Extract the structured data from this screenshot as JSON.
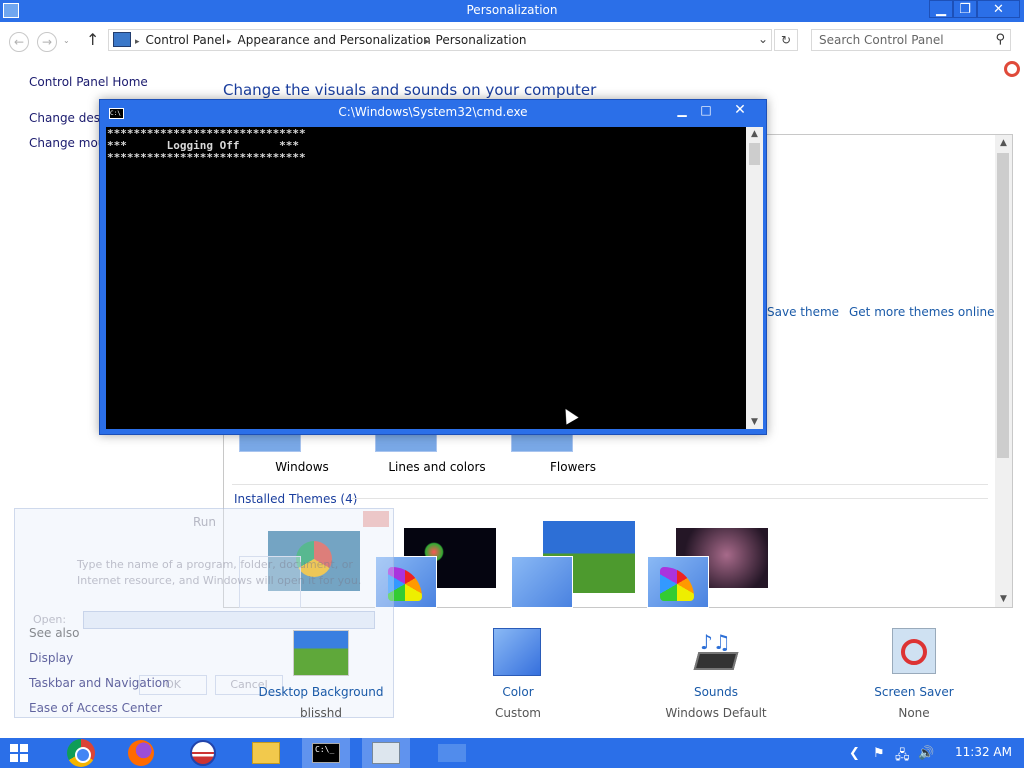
{
  "window": {
    "title": "Personalization",
    "controls": {
      "minimize": "▁",
      "maximize": "❐",
      "close": "✕"
    }
  },
  "address_bar": {
    "back": "←",
    "forward": "→",
    "history": "⌄",
    "up": "↑",
    "crumbs": [
      "Control Panel",
      "Appearance and Personalization",
      "Personalization"
    ],
    "dropdown": "⌄",
    "refresh": "↻",
    "search_placeholder": "Search Control Panel",
    "search_icon": "⚲"
  },
  "left_pane": {
    "home": "Control Panel Home",
    "change_desktop": "Change deskt",
    "change_mouse": "Change mouse",
    "see_also": "See also",
    "links": [
      "Display",
      "Taskbar and Navigation",
      "Ease of Access Center"
    ]
  },
  "main": {
    "heading": "Change the visuals and sounds on your computer",
    "save_theme": "Save theme",
    "more_themes": "Get more themes online",
    "themes": [
      "Windows",
      "Lines and colors",
      "Flowers"
    ],
    "installed_header": "Installed Themes (4)"
  },
  "bottom": [
    {
      "title": "Desktop Background",
      "subtitle": "blisshd"
    },
    {
      "title": "Color",
      "subtitle": "Custom"
    },
    {
      "title": "Sounds",
      "subtitle": "Windows Default"
    },
    {
      "title": "Screen Saver",
      "subtitle": "None"
    }
  ],
  "run_ghost": {
    "title": "Run",
    "description": "Type the name of a program, folder, document, or Internet resource, and Windows will open it for you.",
    "open_label": "Open:",
    "ok": "OK",
    "cancel": "Cancel"
  },
  "cmd": {
    "title": "C:\\Windows\\System32\\cmd.exe",
    "icon_text": "C:\\",
    "controls": {
      "minimize": "▁",
      "maximize": "□",
      "close": "✕"
    },
    "lines": [
      "******************************",
      "***      Logging Off      ***",
      "******************************"
    ],
    "scroll_up": "▲",
    "scroll_down": "▼"
  },
  "taskbar": {
    "clock": "11:32 AM",
    "tray": {
      "chevron": "❮",
      "flag": "⚑",
      "network": "🖧",
      "volume": "🔊"
    },
    "cmd_icon_text": "C:\\_"
  }
}
